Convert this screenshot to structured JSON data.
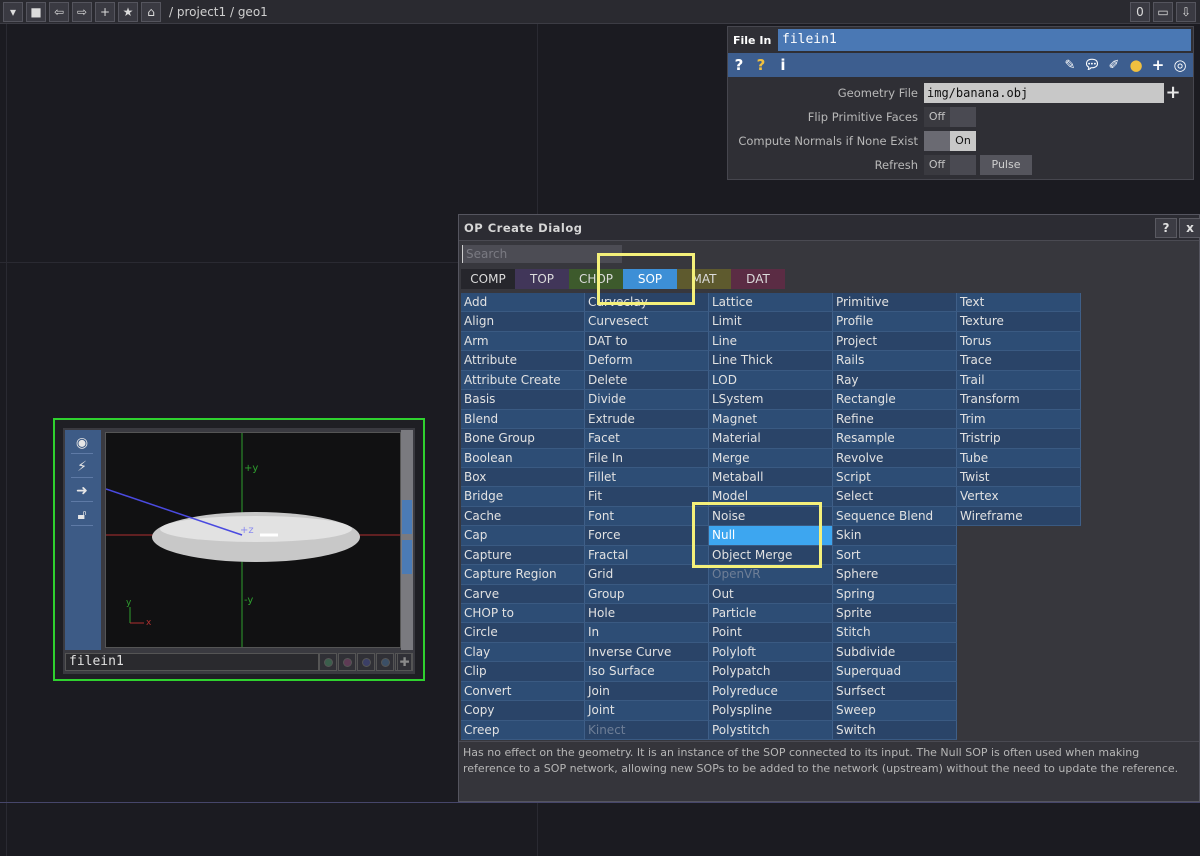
{
  "topbar": {
    "path": "/ project1 / geo1",
    "counter": "0"
  },
  "node": {
    "name": "filein1",
    "viewport": {
      "axis_y_pos": "+y",
      "axis_z_pos": "+z",
      "axis_y_neg": "-y",
      "gizmo_y": "y",
      "gizmo_x": "x"
    }
  },
  "params": {
    "type_label": "File In",
    "node_name": "filein1",
    "rows": [
      {
        "label": "Geometry File",
        "value": "img/banana.obj"
      },
      {
        "label": "Flip Primitive Faces",
        "value": "Off"
      },
      {
        "label": "Compute Normals if None Exist",
        "value": "On"
      },
      {
        "label": "Refresh",
        "value": "Off",
        "pulse": "Pulse"
      }
    ]
  },
  "dialog": {
    "title": "OP Create Dialog",
    "help": "?",
    "close": "x",
    "search_placeholder": "Search",
    "tabs": [
      "COMP",
      "TOP",
      "CHOP",
      "SOP",
      "MAT",
      "DAT"
    ],
    "selected_tab": "SOP",
    "columns": [
      [
        "Add",
        "Align",
        "Arm",
        "Attribute",
        "Attribute Create",
        "Basis",
        "Blend",
        "Bone Group",
        "Boolean",
        "Box",
        "Bridge",
        "Cache",
        "Cap",
        "Capture",
        "Capture Region",
        "Carve",
        "CHOP to",
        "Circle",
        "Clay",
        "Clip",
        "Convert",
        "Copy",
        "Creep"
      ],
      [
        "Curveclay",
        "Curvesect",
        "DAT to",
        "Deform",
        "Delete",
        "Divide",
        "Extrude",
        "Facet",
        "File In",
        "Fillet",
        "Fit",
        "Font",
        "Force",
        "Fractal",
        "Grid",
        "Group",
        "Hole",
        "In",
        "Inverse Curve",
        "Iso Surface",
        "Join",
        "Joint",
        "Kinect"
      ],
      [
        "Lattice",
        "Limit",
        "Line",
        "Line Thick",
        "LOD",
        "LSystem",
        "Magnet",
        "Material",
        "Merge",
        "Metaball",
        "Model",
        "Noise",
        "Null",
        "Object Merge",
        "OpenVR",
        "Out",
        "Particle",
        "Point",
        "Polyloft",
        "Polypatch",
        "Polyreduce",
        "Polyspline",
        "Polystitch"
      ],
      [
        "Primitive",
        "Profile",
        "Project",
        "Rails",
        "Ray",
        "Rectangle",
        "Refine",
        "Resample",
        "Revolve",
        "Script",
        "Select",
        "Sequence Blend",
        "Skin",
        "Sort",
        "Sphere",
        "Spring",
        "Sprite",
        "Stitch",
        "Subdivide",
        "Superquad",
        "Surfsect",
        "Sweep",
        "Switch"
      ],
      [
        "Text",
        "Texture",
        "Torus",
        "Trace",
        "Trail",
        "Transform",
        "Trim",
        "Tristrip",
        "Tube",
        "Twist",
        "Vertex",
        "Wireframe"
      ]
    ],
    "selected_op": "Null",
    "disabled_ops": [
      "Kinect",
      "OpenVR"
    ],
    "description": "Has no effect on the geometry. It is an instance of the SOP connected to its input. The Null SOP is often used when making reference to a SOP network, allowing new SOPs to be added to the network (upstream) without the need to update the reference."
  },
  "colors": {
    "node_border": "#2fd12f",
    "highlight": "#f4f07a",
    "sop_tab": "#3d8fd6",
    "selected_op": "#3da6f0"
  }
}
